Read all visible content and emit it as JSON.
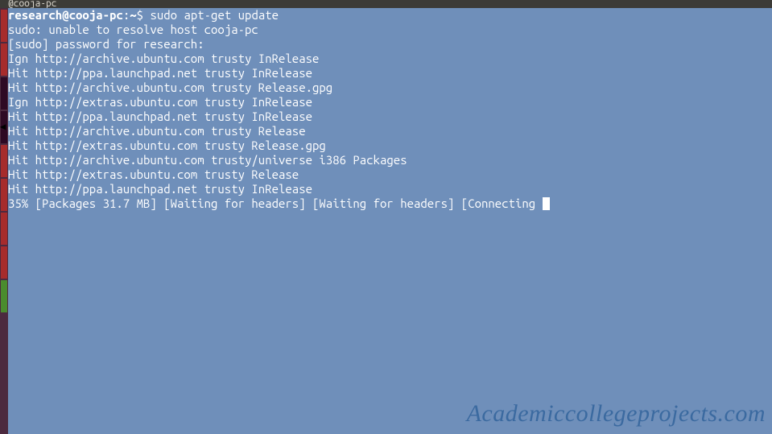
{
  "titlebar": {
    "text": "@cooja-pc"
  },
  "terminal": {
    "prompt": {
      "user_host": "research@cooja-pc",
      "path": "~",
      "symbol": "$"
    },
    "command": "sudo apt-get update",
    "output_lines": [
      "sudo: unable to resolve host cooja-pc",
      "[sudo] password for research:",
      "Ign http://archive.ubuntu.com trusty InRelease",
      "Hit http://ppa.launchpad.net trusty InRelease",
      "Hit http://archive.ubuntu.com trusty Release.gpg",
      "Ign http://extras.ubuntu.com trusty InRelease",
      "Hit http://ppa.launchpad.net trusty InRelease",
      "Hit http://archive.ubuntu.com trusty Release",
      "Hit http://extras.ubuntu.com trusty Release.gpg",
      "Hit http://archive.ubuntu.com trusty/universe i386 Packages",
      "Hit http://extras.ubuntu.com trusty Release",
      "Hit http://ppa.launchpad.net trusty InRelease"
    ],
    "progress_line": "35% [Packages 31.7 MB] [Waiting for headers] [Waiting for headers] [Connecting "
  },
  "watermark": {
    "text": "Academiccollegeprojects.com"
  }
}
